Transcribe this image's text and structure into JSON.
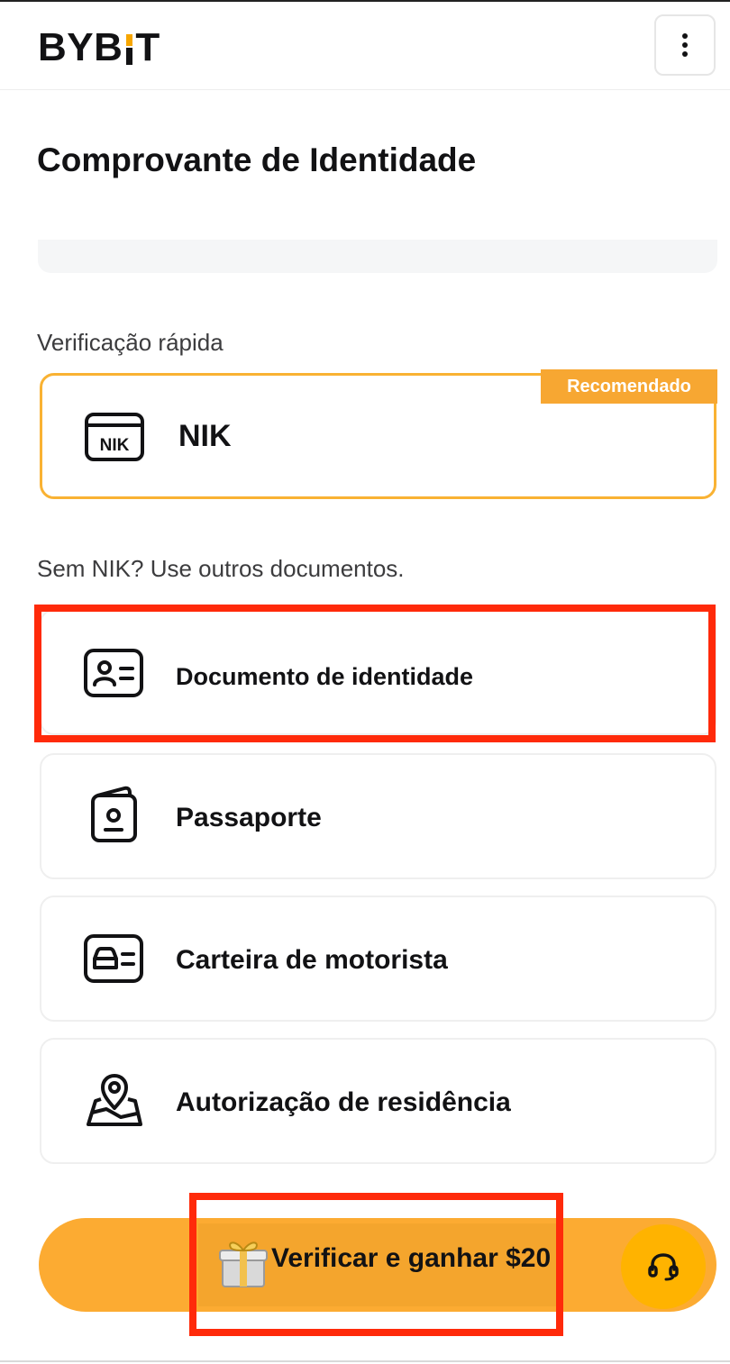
{
  "header": {
    "logo_left": "BYB",
    "logo_right": "T",
    "logo_full": "BYBIT",
    "menu_icon": "more-vertical-icon"
  },
  "page": {
    "title": "Comprovante de Identidade"
  },
  "quick_verification": {
    "label": "Verificação rápida",
    "option": {
      "label": "NIK",
      "icon": "nik-card-icon",
      "badge": "Recomendado"
    }
  },
  "other_documents": {
    "label": "Sem NIK? Use outros documentos.",
    "items": [
      {
        "label": "Documento de identidade",
        "icon": "id-card-icon"
      },
      {
        "label": "Passaporte",
        "icon": "passport-icon"
      },
      {
        "label": "Carteira de motorista",
        "icon": "drivers-license-icon"
      },
      {
        "label": "Autorização de residência",
        "icon": "map-pin-icon"
      }
    ]
  },
  "cta": {
    "label": "Verificar e ganhar $20",
    "icon": "gift-icon"
  },
  "support": {
    "icon": "headset-icon"
  },
  "colors": {
    "brand": "#f7a600",
    "accent_border": "#f9b233",
    "badge_bg": "#f7a732",
    "cta_bg": "#fcab32",
    "highlight": "#ff2a0a",
    "text": "#121214"
  }
}
